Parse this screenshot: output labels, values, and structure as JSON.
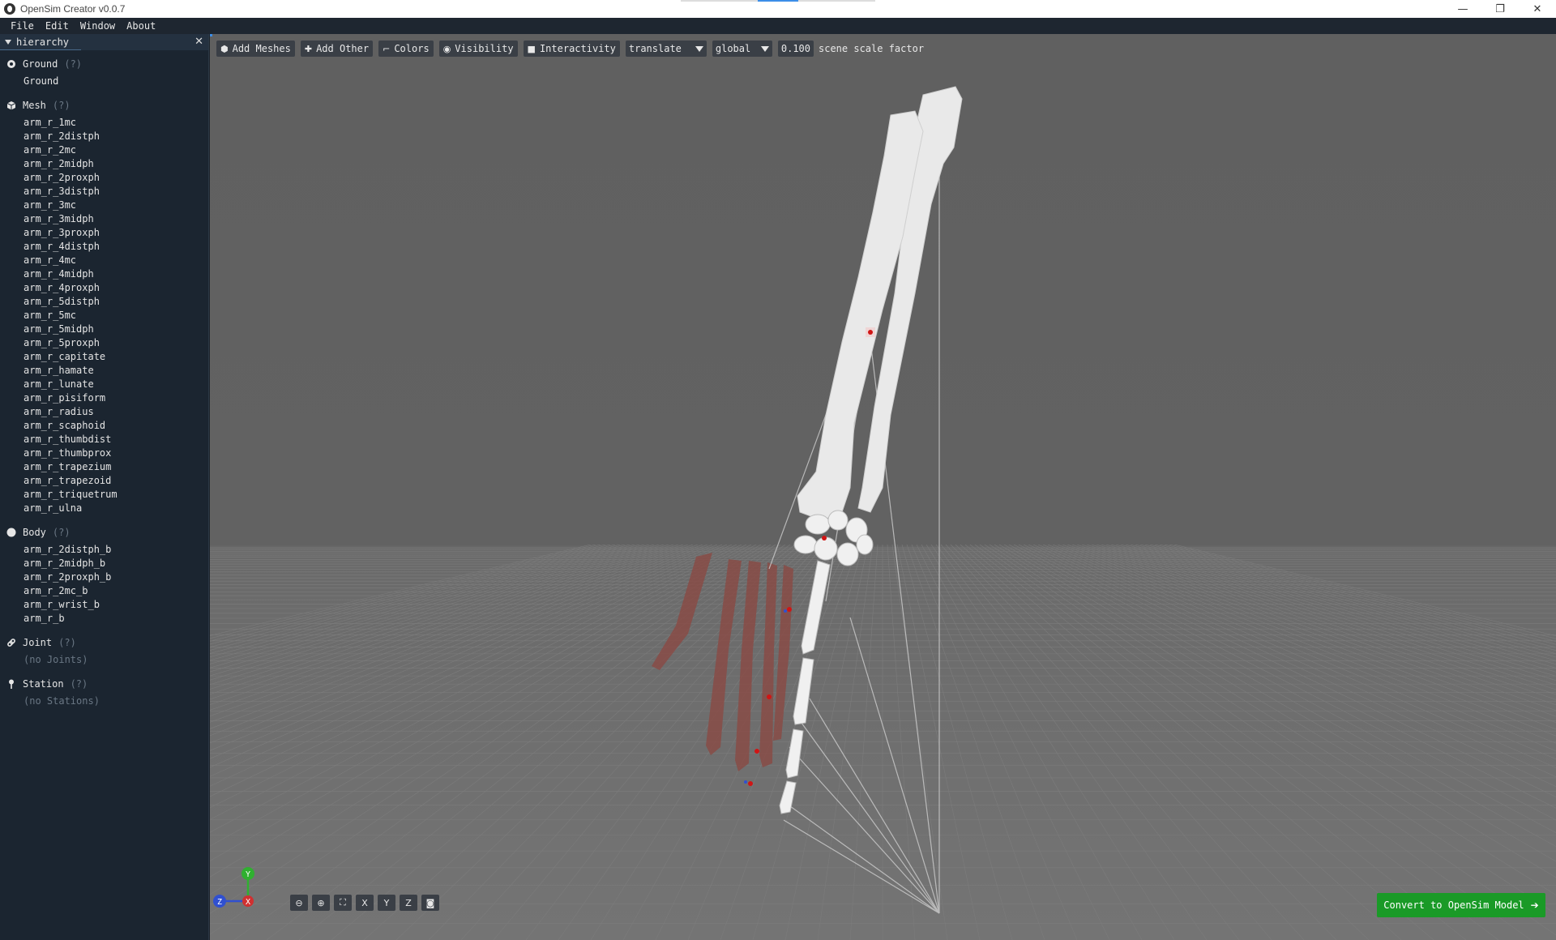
{
  "window": {
    "title": "OpenSim Creator v0.0.7",
    "controls": {
      "minimize": "—",
      "maximize": "❐",
      "close": "✕"
    }
  },
  "menubar": [
    {
      "label": "File"
    },
    {
      "label": "Edit"
    },
    {
      "label": "Window"
    },
    {
      "label": "About"
    }
  ],
  "hierarchy": {
    "title": "hierarchy",
    "close": "✕",
    "groups": [
      {
        "name": "Ground",
        "hint": "(?)",
        "icon": "ground-icon",
        "items": [
          "Ground"
        ]
      },
      {
        "name": "Mesh",
        "hint": "(?)",
        "icon": "mesh-icon",
        "items": [
          "arm_r_1mc",
          "arm_r_2distph",
          "arm_r_2mc",
          "arm_r_2midph",
          "arm_r_2proxph",
          "arm_r_3distph",
          "arm_r_3mc",
          "arm_r_3midph",
          "arm_r_3proxph",
          "arm_r_4distph",
          "arm_r_4mc",
          "arm_r_4midph",
          "arm_r_4proxph",
          "arm_r_5distph",
          "arm_r_5mc",
          "arm_r_5midph",
          "arm_r_5proxph",
          "arm_r_capitate",
          "arm_r_hamate",
          "arm_r_lunate",
          "arm_r_pisiform",
          "arm_r_radius",
          "arm_r_scaphoid",
          "arm_r_thumbdist",
          "arm_r_thumbprox",
          "arm_r_trapezium",
          "arm_r_trapezoid",
          "arm_r_triquetrum",
          "arm_r_ulna"
        ]
      },
      {
        "name": "Body",
        "hint": "(?)",
        "icon": "body-icon",
        "items": [
          "arm_r_2distph_b",
          "arm_r_2midph_b",
          "arm_r_2proxph_b",
          "arm_r_2mc_b",
          "arm_r_wrist_b",
          "arm_r_b"
        ]
      },
      {
        "name": "Joint",
        "hint": "(?)",
        "icon": "link-icon",
        "items": [],
        "empty": "(no Joints)"
      },
      {
        "name": "Station",
        "hint": "(?)",
        "icon": "pin-icon",
        "items": [],
        "empty": "(no Stations)"
      }
    ]
  },
  "toolbar": {
    "add_meshes": "Add Meshes",
    "add_other": "Add Other",
    "colors": "Colors",
    "visibility": "Visibility",
    "interactivity": "Interactivity",
    "manipulator_mode": "translate",
    "manipulator_space": "global",
    "scale_value": "0.100",
    "scale_label": "scene scale factor"
  },
  "axes": {
    "y": "Y",
    "z": "Z",
    "x": "X"
  },
  "camera_buttons": {
    "zoom_out": "zoom-out-icon",
    "zoom_in": "zoom-in-icon",
    "fit": "fit-icon",
    "x": "X",
    "y": "Y",
    "z": "Z",
    "screenshot": "camera-icon"
  },
  "convert": {
    "label": "Convert to OpenSim Model",
    "arrow": "➔"
  },
  "colors": {
    "accent": "#3c8ee8",
    "convert_green": "#1a9a27",
    "bone": "#e8e8e8",
    "ghost_bone": "#8a4a44",
    "marker_red": "#d01515",
    "axis_x": "#d03030",
    "axis_y": "#30b030",
    "axis_z": "#3050d0"
  }
}
